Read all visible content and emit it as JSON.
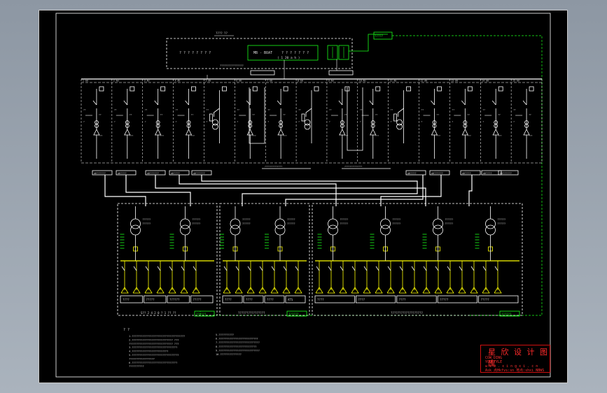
{
  "sheet": {
    "colors": {
      "background": "#000000",
      "line": "#ffffff",
      "text": "#d8d8d8",
      "green": "#19ff19",
      "yellow": "#ffff00",
      "red": "#ff2020"
    }
  },
  "top_panel": {
    "header_label": "???? ??",
    "display_label": "MB - BOAT",
    "display_digits": "? ? ? ? ? ? ?",
    "display_subtitle": "( 1 20 a h )",
    "left_digits": "? ? ? ? ? ? ? ?",
    "bus_caption": "????????????????",
    "green_tag": "?????"
  },
  "breaker_columns": {
    "count": 15,
    "labels": [
      "1 AH",
      "2 AH",
      "3 AH",
      "4 AH",
      "5 AH",
      "6 AH",
      "7 AH",
      "8 AH",
      "9 AH",
      "10 AH",
      "11 AH",
      "12 AH",
      "13 AH",
      "14 AH",
      "15 AH"
    ]
  },
  "feeder_tags": [
    "AH??????",
    "AH????",
    "AH??????",
    "AH????",
    "AH??????",
    "AH????",
    "AH??????",
    "AH????",
    "AH????",
    "AH??????"
  ],
  "substations": [
    {
      "title": "S?? 2 4 2 0 ? 1 ??  ??",
      "tag": "??????",
      "feeder_labels": [
        "????",
        "?????",
        "??????",
        "?????"
      ]
    },
    {
      "title": "????????????????",
      "tag": "??????",
      "feeder_labels": [
        "????",
        "????",
        "????",
        "ATS"
      ]
    },
    {
      "title": "???????????????????",
      "tag": "??????",
      "feeder_labels": [
        "????",
        "????",
        "????",
        "?????",
        "?????"
      ]
    }
  ],
  "notes": {
    "heading": "? ?",
    "left": [
      "1.???????????????????????????????????",
      "2.???????????????????????????  ???",
      "  ?????????????????????????????  ???",
      "3.??????????????????????????????",
      "4.????????????????????????",
      "5.???????????????????????????????",
      "  ?????????????????",
      "6.??????????????????????????????",
      "  ??????????"
    ],
    "right": [
      "5.??????????",
      "6.??????????????????????????",
      "7.???????????????????????????",
      "8.?????????????????????????",
      "9.???????????????????????????",
      "10.??????????????"
    ]
  },
  "stamp": {
    "title": "星 欣 设 计 图 库",
    "lines": [
      "COW DING",
      "YOUSTYLE",
      "w w w . x i n g x i . c n",
      "Ask 点Hkfvs:sn 地点:shxi NBWS"
    ]
  }
}
